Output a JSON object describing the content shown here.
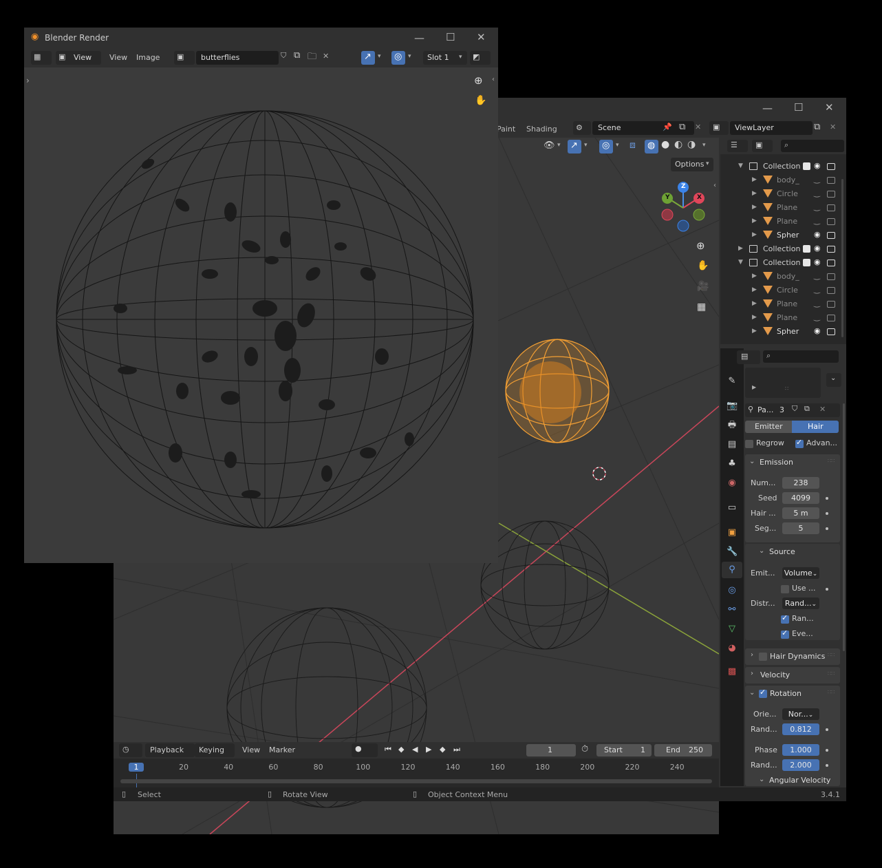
{
  "render_window": {
    "title": "Blender Render",
    "toolbar": {
      "view_menu": "View",
      "view_menu2": "View",
      "image_menu": "Image",
      "image_name": "butterflies",
      "slot": "Slot 1"
    }
  },
  "main_window": {
    "workspace_tabs": [
      "Paint",
      "Shading"
    ],
    "scene": "Scene",
    "view_layer": "ViewLayer",
    "options_label": "Options"
  },
  "outliner": {
    "rows": [
      {
        "label": "Collection",
        "type": "collection",
        "expanded": true,
        "checked": true,
        "visible": true
      },
      {
        "label": "body_",
        "type": "mesh",
        "expanded": false,
        "visible": false
      },
      {
        "label": "Circle",
        "type": "mesh",
        "expanded": false,
        "visible": false
      },
      {
        "label": "Plane",
        "type": "mesh",
        "expanded": false,
        "visible": false
      },
      {
        "label": "Plane",
        "type": "mesh",
        "expanded": false,
        "visible": false
      },
      {
        "label": "Spher",
        "type": "mesh",
        "expanded": false,
        "visible": true
      },
      {
        "label": "Collection",
        "type": "collection",
        "expanded": false,
        "checked": true,
        "visible": true
      },
      {
        "label": "Collection",
        "type": "collection",
        "expanded": true,
        "checked": true,
        "visible": true
      },
      {
        "label": "body_",
        "type": "mesh",
        "expanded": false,
        "visible": false
      },
      {
        "label": "Circle",
        "type": "mesh",
        "expanded": false,
        "visible": false
      },
      {
        "label": "Plane",
        "type": "mesh",
        "expanded": false,
        "visible": false
      },
      {
        "label": "Plane",
        "type": "mesh",
        "expanded": false,
        "visible": false
      },
      {
        "label": "Spher",
        "type": "mesh",
        "expanded": false,
        "visible": true
      }
    ]
  },
  "properties": {
    "particle_system_name": "Pa...",
    "users": "3",
    "type_emitter": "Emitter",
    "type_hair": "Hair",
    "regrow": "Regrow",
    "advanced": "Advan...",
    "emission": {
      "title": "Emission",
      "number_label": "Num...",
      "number": "238",
      "seed_label": "Seed",
      "seed": "4099",
      "hair_length_label": "Hair ...",
      "hair_length": "5 m",
      "segments_label": "Seg...",
      "segments": "5"
    },
    "source": {
      "title": "Source",
      "emit_from_label": "Emit...",
      "emit_from": "Volume",
      "use_label": "Use ...",
      "distribution_label": "Distr...",
      "distribution": "Rand...",
      "random_label": "Ran...",
      "even_label": "Eve..."
    },
    "hair_dynamics": "Hair Dynamics",
    "velocity": "Velocity",
    "rotation": {
      "title": "Rotation",
      "orient_label": "Orie...",
      "orient": "Nor...",
      "rand1_label": "Rand...",
      "rand1": "0.812",
      "phase_label": "Phase",
      "phase": "1.000",
      "rand2_label": "Rand...",
      "rand2": "2.000"
    },
    "angular_velocity": "Angular Velocity"
  },
  "timeline": {
    "menus": [
      "Playback",
      "Keying",
      "View",
      "Marker"
    ],
    "current_frame": "1",
    "start_label": "Start",
    "start": "1",
    "end_label": "End",
    "end": "250",
    "ticks": [
      "1",
      "20",
      "40",
      "60",
      "80",
      "100",
      "120",
      "140",
      "160",
      "180",
      "200",
      "220",
      "240"
    ]
  },
  "statusbar": {
    "select": "Select",
    "rotate": "Rotate View",
    "context": "Object Context Menu",
    "version": "3.4.1"
  },
  "gizmo": {
    "x": "X",
    "y": "Y",
    "z": "Z"
  },
  "colors": {
    "accent_blue": "#4772b3",
    "selected_orange": "#f5a033",
    "axis_red": "#c9465a",
    "axis_green": "#8ba33a"
  }
}
